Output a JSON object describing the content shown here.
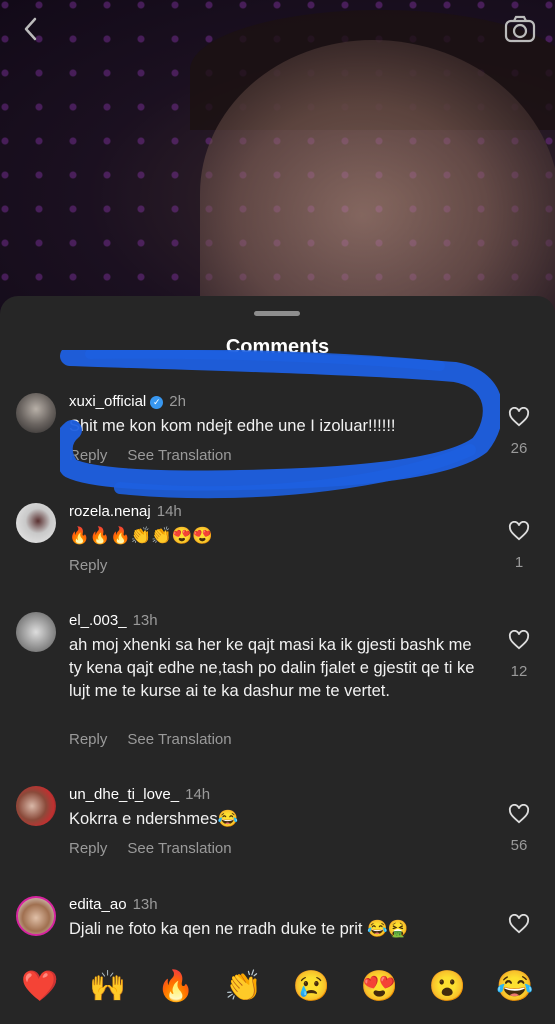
{
  "header": {
    "title": "Comments"
  },
  "comments": [
    {
      "user": "xuxi_official",
      "verified": true,
      "time": "2h",
      "text": "Shit me kon kom ndejt edhe une I izoluar!!!!!!",
      "reply": "Reply",
      "translate": "See Translation",
      "likes": "26"
    },
    {
      "user": "rozela.nenaj",
      "time": "14h",
      "text": "🔥🔥🔥👏👏😍😍",
      "reply": "Reply",
      "likes": "1"
    },
    {
      "user": "el_.003_",
      "time": "13h",
      "text": "ah moj xhenki sa her ke qajt masi ka ik gjesti bashk me ty kena qajt edhe ne,tash po dalin fjalet e gjestit qe ti ke lujt me te kurse ai te ka dashur me te vertet.",
      "reply": "Reply",
      "translate": "See Translation",
      "likes": "12"
    },
    {
      "user": "un_dhe_ti_love_",
      "time": "14h",
      "text": "Kokrra e ndershmes😂",
      "reply": "Reply",
      "translate": "See Translation",
      "likes": "56"
    },
    {
      "user": "edita_ao",
      "time": "13h",
      "text": "Djali ne foto ka qen ne rradh duke te prit 😂🤮",
      "likes": ""
    }
  ],
  "quick_reactions": [
    "❤️",
    "🙌",
    "🔥",
    "👏",
    "😢",
    "😍",
    "😮",
    "😂"
  ],
  "colors": {
    "sheet": "#262626",
    "scribble": "#1d5fe0",
    "verified": "#3897f0",
    "secondary_text": "#9a9a9a"
  }
}
